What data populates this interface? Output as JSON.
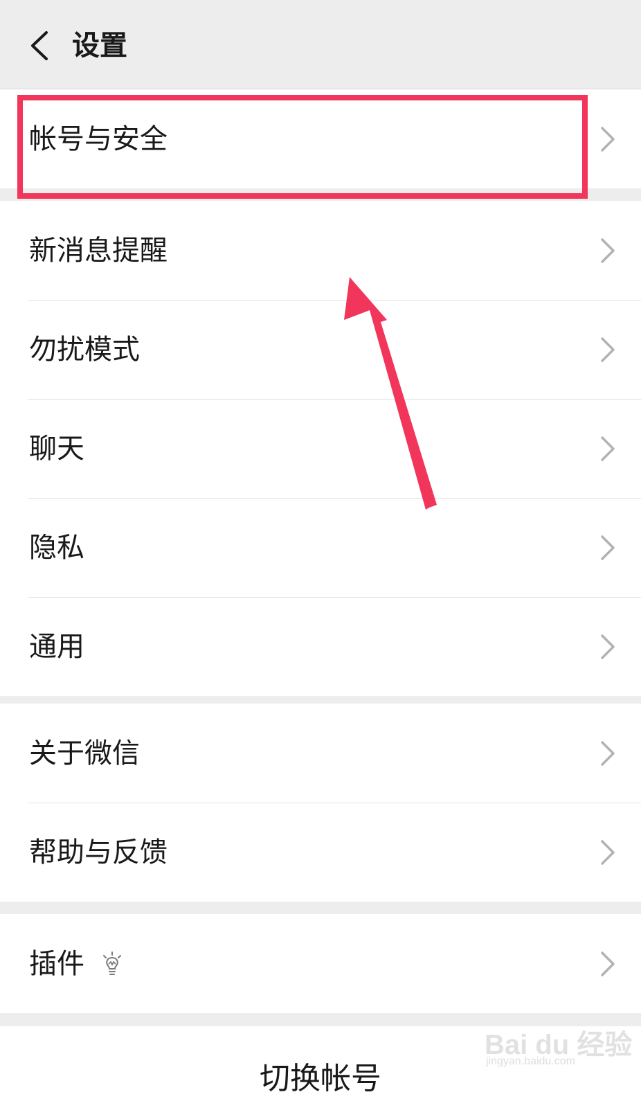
{
  "header": {
    "title": "设置",
    "back_icon": "chevron-left-icon"
  },
  "groups": [
    {
      "items": [
        {
          "label": "帐号与安全"
        }
      ]
    },
    {
      "items": [
        {
          "label": "新消息提醒"
        },
        {
          "label": "勿扰模式"
        },
        {
          "label": "聊天"
        },
        {
          "label": "隐私"
        },
        {
          "label": "通用"
        }
      ]
    },
    {
      "items": [
        {
          "label": "关于微信"
        },
        {
          "label": "帮助与反馈"
        }
      ]
    },
    {
      "items": [
        {
          "label": "插件",
          "icon": "lightbulb-icon"
        }
      ]
    }
  ],
  "bottom": {
    "switch_account": "切换帐号"
  },
  "annotation": {
    "color": "#f2355a",
    "target": "帐号与安全"
  },
  "watermark": {
    "main": "Bai du 经验",
    "sub": "jingyan.baidu.com"
  },
  "colors": {
    "background": "#ededed",
    "row": "#ffffff",
    "text": "#191919",
    "chevron": "#b2b2b2"
  }
}
